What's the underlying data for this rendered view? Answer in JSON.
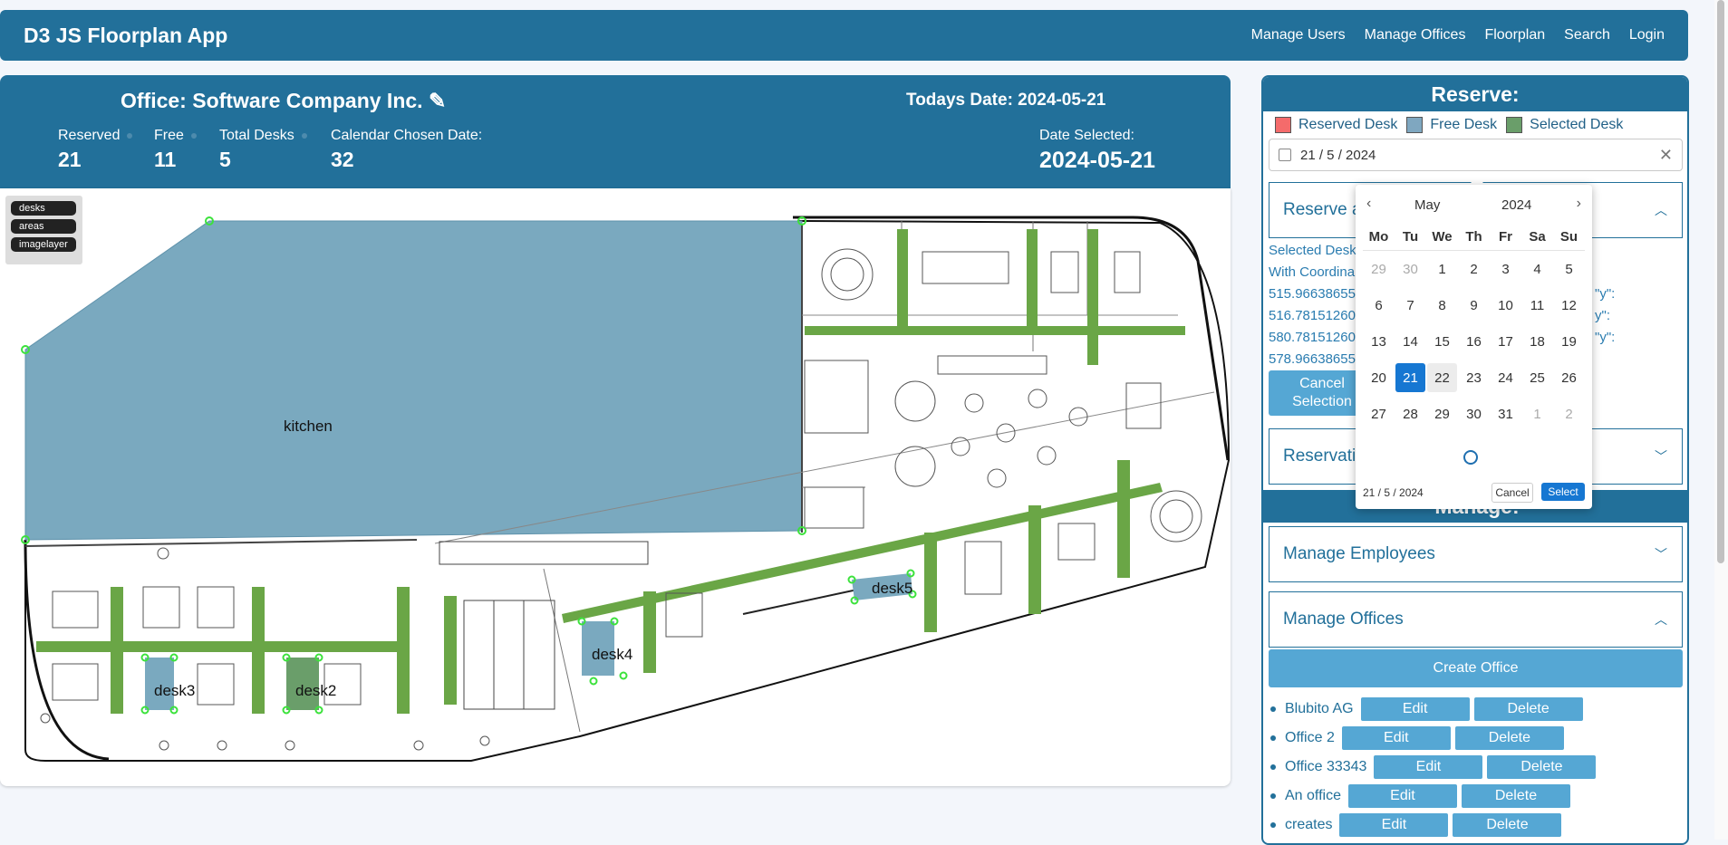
{
  "navbar": {
    "brand": "D3 JS Floorplan App",
    "links": [
      "Manage Users",
      "Manage Offices",
      "Floorplan",
      "Search",
      "Login"
    ]
  },
  "office": {
    "title": "Office: Software Company Inc. ✎",
    "today": "Todays Date: 2024-05-21",
    "stats": [
      {
        "label": "Reserved",
        "value": "21"
      },
      {
        "label": "Free",
        "value": "11"
      },
      {
        "label": "Total Desks",
        "value": "5"
      },
      {
        "label": "Calendar Chosen Date:",
        "value": "32"
      }
    ],
    "date_selected_label": "Date Selected:",
    "date_selected_value": "2024-05-21"
  },
  "floorplan": {
    "layers": [
      "desks",
      "areas",
      "imagelayer"
    ],
    "labels": {
      "kitchen": "kitchen",
      "desk2": "desk2",
      "desk3": "desk3",
      "desk4": "desk4",
      "desk5": "desk5"
    }
  },
  "colors": {
    "primary": "#22709a",
    "reserved": "#f46b6b",
    "free": "#7fa7c0",
    "selected": "#6a9e6a",
    "button": "#55a7d4"
  },
  "sidebar": {
    "title": "Reserve:",
    "legend": [
      {
        "label": "Reserved Desk",
        "color": "#f46b6b"
      },
      {
        "label": "Free Desk",
        "color": "#7fa7c0"
      },
      {
        "label": "Selected Desk",
        "color": "#6a9e6a"
      }
    ],
    "date_value": "21 / 5 / 2024",
    "reserve_label": "Reserve a",
    "selection_lines": [
      "Selected Desk",
      "With Coordina",
      "515.96638655",
      "516.78151260",
      "580.78151260",
      "578.96638655"
    ],
    "selection_lines_right": [
      "\"y\":",
      "y\":",
      "\"y\":"
    ],
    "cancel_label": "Cancel Selection",
    "reservations_label": "Reservati",
    "manage_title": "Manage:",
    "manage_employees": "Manage Employees",
    "manage_offices": "Manage Offices",
    "create_office": "Create Office",
    "offices": [
      {
        "name": "Blubito AG"
      },
      {
        "name": "Office 2"
      },
      {
        "name": "Office 33343"
      },
      {
        "name": "An office"
      },
      {
        "name": "creates"
      }
    ],
    "edit_label": "Edit",
    "delete_label": "Delete"
  },
  "datepicker": {
    "month": "May",
    "year": "2024",
    "weekdays": [
      "Mo",
      "Tu",
      "We",
      "Th",
      "Fr",
      "Sa",
      "Su"
    ],
    "days": [
      [
        "29",
        "30",
        "1",
        "2",
        "3",
        "4",
        "5"
      ],
      [
        "6",
        "7",
        "8",
        "9",
        "10",
        "11",
        "12"
      ],
      [
        "13",
        "14",
        "15",
        "16",
        "17",
        "18",
        "19"
      ],
      [
        "20",
        "21",
        "22",
        "23",
        "24",
        "25",
        "26"
      ],
      [
        "27",
        "28",
        "29",
        "30",
        "31",
        "1",
        "2"
      ]
    ],
    "footer_date": "21 / 5 / 2024",
    "cancel": "Cancel",
    "select": "Select"
  }
}
